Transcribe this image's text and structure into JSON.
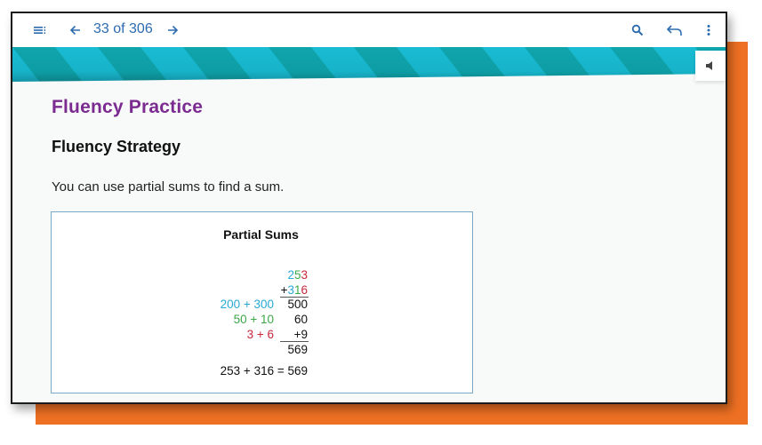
{
  "toolbar": {
    "menu_icon": "menu-list-icon",
    "prev_icon": "arrow-left-icon",
    "page_indicator": "33 of 306",
    "next_icon": "arrow-right-icon",
    "search_icon": "search-icon",
    "back_icon": "undo-back-icon",
    "more_icon": "more-vertical-icon"
  },
  "audio_icon": "speaker-icon",
  "colors": {
    "accent_blue": "#2d6bb0",
    "title_purple": "#7b2a8f",
    "banner_teal": "#0fa5ad",
    "banner_cyan": "#18bcd3",
    "frame_orange": "#ee7022",
    "hundreds_blue": "#27a9d6",
    "tens_green": "#3aa847",
    "ones_red": "#c8283a"
  },
  "content": {
    "section_title": "Fluency Practice",
    "subsection_title": "Fluency Strategy",
    "intro_text": "You can use partial sums to find a sum.",
    "box": {
      "title": "Partial Sums",
      "addend1": {
        "hundreds": "2",
        "tens": "5",
        "ones": "3"
      },
      "addend2": {
        "sign": "+",
        "hundreds": "3",
        "tens": "1",
        "ones": "6"
      },
      "partials": [
        {
          "expression": "200 + 300",
          "value": "500",
          "color": "blue"
        },
        {
          "expression": "50 + 10",
          "value": "60",
          "color": "green"
        },
        {
          "expression": "3 + 6",
          "value": "+9",
          "color": "red"
        }
      ],
      "total": "569",
      "equation": "253 + 316 = 569"
    }
  }
}
